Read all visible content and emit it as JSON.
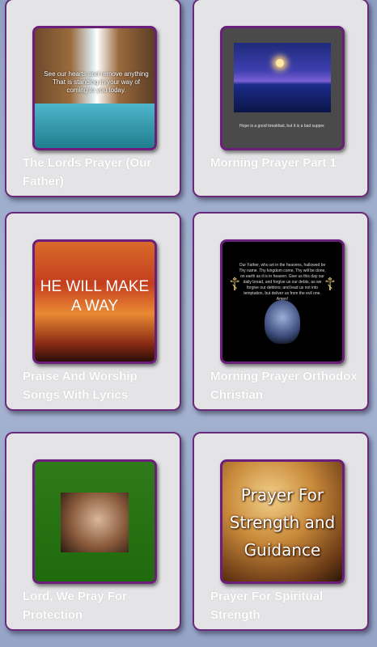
{
  "cards": [
    {
      "title": "The Lords Prayer (Our Father)",
      "thumb_text": "See our hearts and remove anything That is standing in your way of coming to you today."
    },
    {
      "title": "Morning Prayer Part 1",
      "thumb_caption": "Hope is a good breakfast, but it is a bad supper."
    },
    {
      "title": "Praise And Worship Songs With Lyrics",
      "thumb_text": "HE WILL MAKE A WAY"
    },
    {
      "title": "Morning Prayer Orthodox Christian",
      "thumb_text": "Our Father, who art in the heavens, hallowed be Thy name. Thy kingdom come, Thy will be done, on earth as it is in heaven. Give us this day our daily bread, and forgive us our debts, as we forgive our debtors; and lead us not into temptation, but deliver us from the evil one. Amen!"
    },
    {
      "title": "Lord, We Pray For Protection"
    },
    {
      "title": "Prayer For Spiritual Strength",
      "thumb_text": "Prayer For Strength and Guidance"
    }
  ]
}
